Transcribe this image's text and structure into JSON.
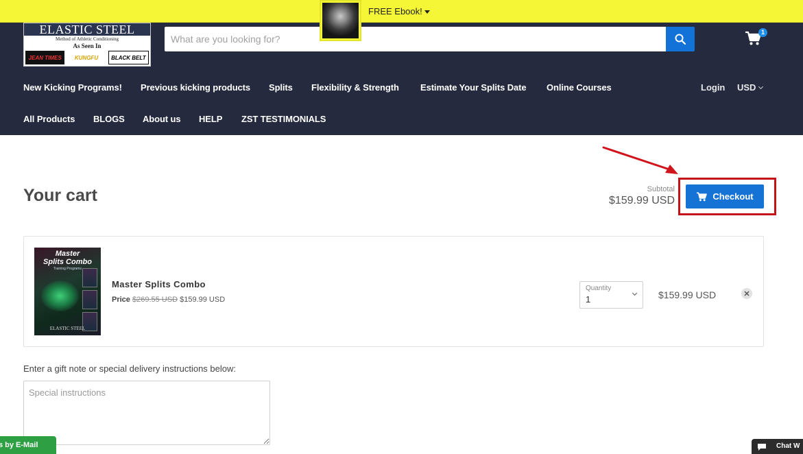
{
  "promo": {
    "text": "FREE Ebook!"
  },
  "header": {
    "logo": {
      "brand": "ELASTIC STEEL",
      "tagline": "Method of Athletic Conditioning",
      "seen_in": "As Seen In",
      "publications": [
        "JEAN TIMES",
        "KUNGFU",
        "BLACK BELT"
      ]
    },
    "search": {
      "placeholder": "What are you looking for?"
    },
    "cart_count": "1",
    "nav_row1": [
      "New Kicking Programs!",
      "Previous kicking products",
      "Splits",
      "Flexibility & Strength",
      "Estimate Your Splits Date",
      "Online Courses"
    ],
    "nav_row2": [
      "All Products",
      "BLOGS",
      "About us",
      "HELP",
      "ZST TESTIMONIALS"
    ],
    "login": "Login",
    "currency": "USD"
  },
  "cart": {
    "title": "Your cart",
    "subtotal_label": "Subtotal",
    "subtotal_value": "$159.99 USD",
    "checkout_label": "Checkout",
    "item": {
      "image_title1": "Master",
      "image_title2": "Splits Combo",
      "image_subtitle": "Training Programs",
      "image_logo": "ELASTIC STEEL",
      "name": "Master Splits Combo",
      "price_label": "Price",
      "original_price": "$269.55 USD",
      "price": "$159.99 USD",
      "quantity_label": "Quantity",
      "quantity": "1",
      "line_total": "$159.99 USD"
    },
    "note_label": "Enter a gift note or special delivery instructions below:",
    "note_placeholder": "Special instructions"
  },
  "widgets": {
    "email": "Us by E-Mail",
    "chat": "Chat W"
  },
  "colors": {
    "promo_bg": "#f4f636",
    "header_bg": "#262a3f",
    "accent": "#1673d6",
    "highlight": "#c4121b"
  }
}
